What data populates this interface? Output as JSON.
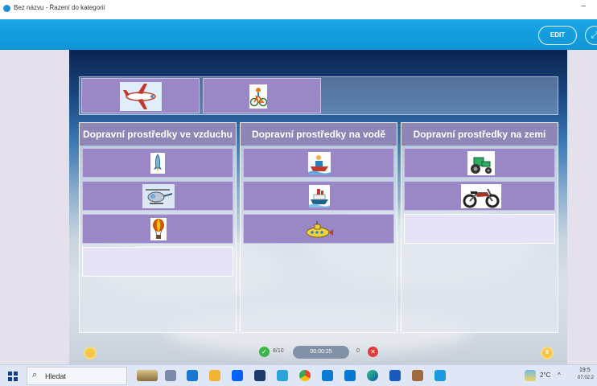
{
  "window": {
    "title": "Bez názvu - Řazení do kategorií",
    "minimize_glyph": "–"
  },
  "toolbar": {
    "edit_label": "EDIT",
    "fullscreen_glyph": "⤢"
  },
  "source_items": [
    {
      "icon": "airplane-icon"
    },
    {
      "icon": "bicycle-icon"
    }
  ],
  "categories": [
    {
      "title": "Dopravní prostředky ve vzduchu",
      "items": [
        {
          "icon": "rocket-icon"
        },
        {
          "icon": "helicopter-icon"
        },
        {
          "icon": "hot-air-balloon-icon"
        }
      ],
      "empty_slots": 1
    },
    {
      "title": "Dopravní prostředky na vodě",
      "items": [
        {
          "icon": "motorboat-icon"
        },
        {
          "icon": "steamship-icon"
        },
        {
          "icon": "submarine-icon"
        }
      ],
      "empty_slots": 0
    },
    {
      "title": "Dopravní prostředky na zemi",
      "items": [
        {
          "icon": "tractor-icon"
        },
        {
          "icon": "motorcycle-icon"
        }
      ],
      "empty_slots": 1
    }
  ],
  "status": {
    "correct_count": "8/10",
    "timer": "00:00:25",
    "error_count": "0",
    "check_glyph": "✓",
    "error_glyph": "✕"
  },
  "bottom_buttons": {
    "left_glyph": "",
    "right_glyph": "II"
  },
  "taskbar": {
    "search_label": "Hledat",
    "search_glyph": "⌕",
    "weather": "2°C",
    "tray_arrow": "^",
    "time": "19:5",
    "date": "07.02.2"
  },
  "colors": {
    "toolbar": "#1aa6e5",
    "card": "#9a87c6",
    "header": "#8e86b6",
    "empty_slot": "#e6e2f8"
  }
}
